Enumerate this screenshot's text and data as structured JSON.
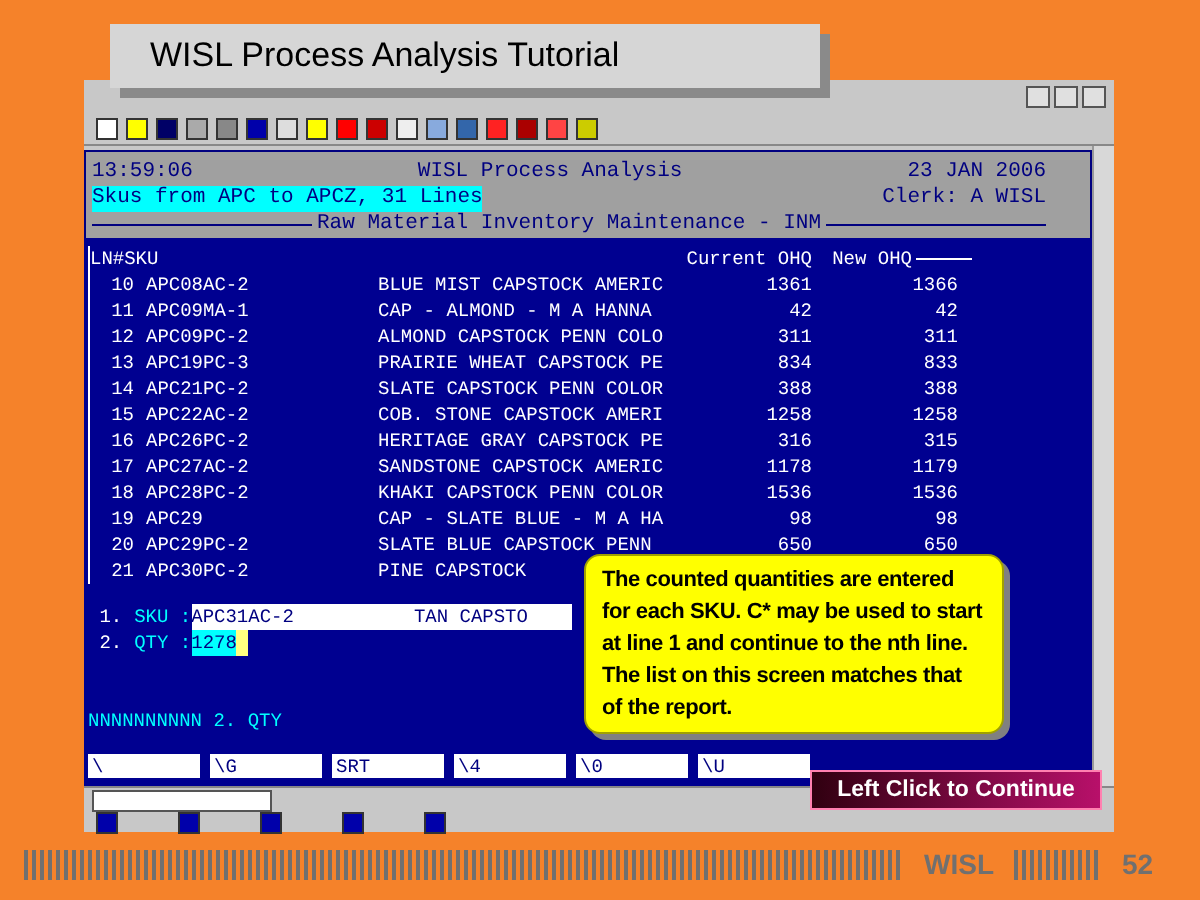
{
  "slide_title": "WISL Process Analysis Tutorial",
  "terminal": {
    "time": "13:59:06",
    "title": "WISL Process Analysis",
    "date": "23 JAN 2006",
    "filter": "Skus from APC to APCZ, 31 Lines",
    "clerk": "Clerk: A WISL",
    "screen_title": "Raw Material Inventory Maintenance - INM",
    "columns": [
      "LN#SKU",
      "Current OHQ",
      "New OHQ"
    ],
    "rows": [
      {
        "ln": "10",
        "sku": "APC08AC-2",
        "description": "BLUE MIST CAPSTOCK AMERIC",
        "current_ohq": "1361",
        "new_ohq": "1366"
      },
      {
        "ln": "11",
        "sku": "APC09MA-1",
        "description": "CAP - ALMOND - M A HANNA",
        "current_ohq": "42",
        "new_ohq": "42"
      },
      {
        "ln": "12",
        "sku": "APC09PC-2",
        "description": "ALMOND CAPSTOCK PENN COLO",
        "current_ohq": "311",
        "new_ohq": "311"
      },
      {
        "ln": "13",
        "sku": "APC19PC-3",
        "description": "PRAIRIE WHEAT CAPSTOCK PE",
        "current_ohq": "834",
        "new_ohq": "833"
      },
      {
        "ln": "14",
        "sku": "APC21PC-2",
        "description": "SLATE CAPSTOCK PENN COLOR",
        "current_ohq": "388",
        "new_ohq": "388"
      },
      {
        "ln": "15",
        "sku": "APC22AC-2",
        "description": "COB. STONE CAPSTOCK AMERI",
        "current_ohq": "1258",
        "new_ohq": "1258"
      },
      {
        "ln": "16",
        "sku": "APC26PC-2",
        "description": "HERITAGE GRAY CAPSTOCK PE",
        "current_ohq": "316",
        "new_ohq": "315"
      },
      {
        "ln": "17",
        "sku": "APC27AC-2",
        "description": "SANDSTONE CAPSTOCK AMERIC",
        "current_ohq": "1178",
        "new_ohq": "1179"
      },
      {
        "ln": "18",
        "sku": "APC28PC-2",
        "description": "KHAKI CAPSTOCK PENN COLOR",
        "current_ohq": "1536",
        "new_ohq": "1536"
      },
      {
        "ln": "19",
        "sku": "APC29",
        "description": "CAP - SLATE BLUE - M A HA",
        "current_ohq": "98",
        "new_ohq": "98"
      },
      {
        "ln": "20",
        "sku": "APC29PC-2",
        "description": "SLATE BLUE CAPSTOCK PENN",
        "current_ohq": "650",
        "new_ohq": "650"
      },
      {
        "ln": "21",
        "sku": "APC30PC-2",
        "description": "PINE CAPSTOCK"
      }
    ],
    "form": [
      {
        "number": "1.",
        "label": "SKU :",
        "value": "APC31AC-2",
        "extra": "TAN CAPSTO",
        "kind": "text"
      },
      {
        "number": "2.",
        "label": "QTY :",
        "value": "1278",
        "kind": "active"
      }
    ],
    "prompt": "NNNNNNNNNN 2. QTY",
    "function_keys": [
      "\\",
      "\\G",
      "SRT",
      "\\4",
      "\\0",
      "\\U"
    ]
  },
  "callout": "The counted quantities are entered for each SKU. C* may be used to start at line 1 and continue to the nth line. The list on this screen matches that of the report.",
  "continue_button": "Left Click to Continue",
  "footer": {
    "brand": "WISL",
    "page": "52"
  }
}
